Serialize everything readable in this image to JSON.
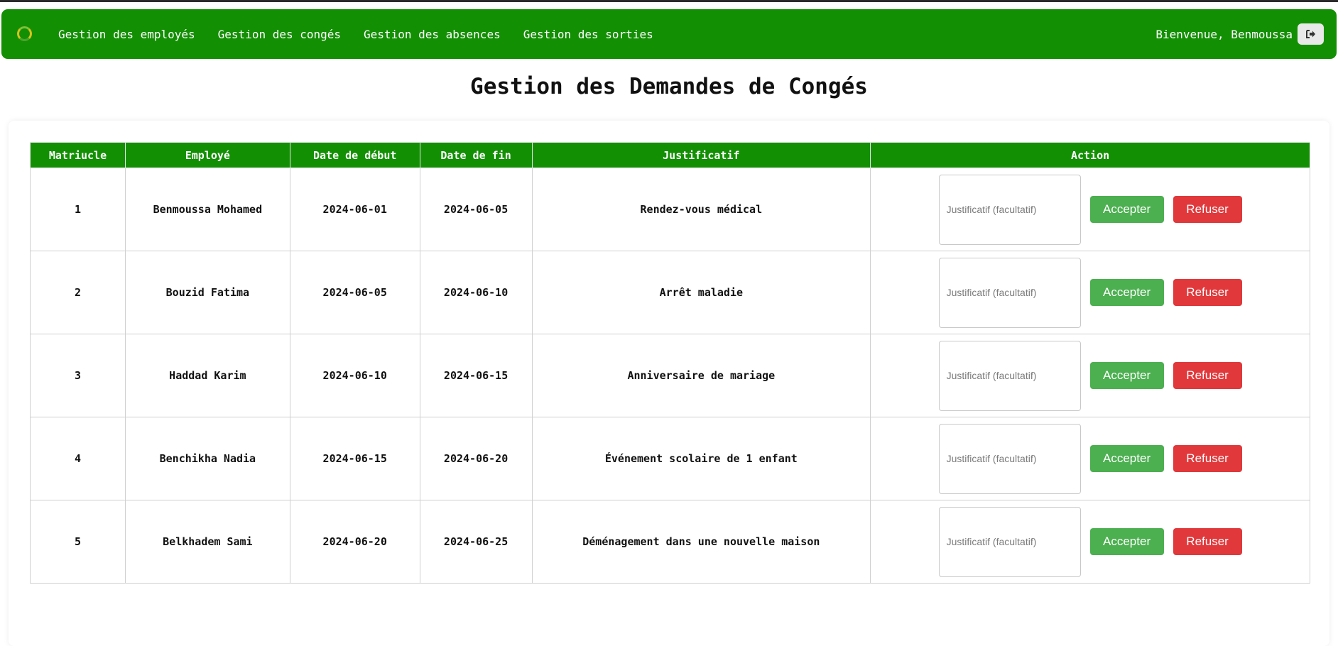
{
  "nav": {
    "links": [
      "Gestion des employés",
      "Gestion des congés",
      "Gestion des absences",
      "Gestion des sorties"
    ],
    "welcome": "Bienvenue, Benmoussa",
    "logout_icon": "sign-out-icon"
  },
  "page": {
    "title": "Gestion des Demandes de Congés"
  },
  "table": {
    "headers": [
      "Matriucle",
      "Employé",
      "Date de début",
      "Date de fin",
      "Justificatif",
      "Action"
    ],
    "rows": [
      {
        "matricule": "1",
        "employe": "Benmoussa Mohamed",
        "debut": "2024-06-01",
        "fin": "2024-06-05",
        "justificatif": "Rendez-vous médical"
      },
      {
        "matricule": "2",
        "employe": "Bouzid Fatima",
        "debut": "2024-06-05",
        "fin": "2024-06-10",
        "justificatif": "Arrêt maladie"
      },
      {
        "matricule": "3",
        "employe": "Haddad Karim",
        "debut": "2024-06-10",
        "fin": "2024-06-15",
        "justificatif": "Anniversaire de mariage"
      },
      {
        "matricule": "4",
        "employe": "Benchikha Nadia",
        "debut": "2024-06-15",
        "fin": "2024-06-20",
        "justificatif": "Événement scolaire de 1 enfant"
      },
      {
        "matricule": "5",
        "employe": "Belkhadem Sami",
        "debut": "2024-06-20",
        "fin": "2024-06-25",
        "justificatif": "Déménagement dans une nouvelle maison"
      }
    ],
    "action": {
      "input_placeholder": "Justificatif (facultatif)",
      "accept_label": "Accepter",
      "refuse_label": "Refuser"
    }
  },
  "colors": {
    "brand": "#138f04",
    "accept": "#4caf50",
    "refuse": "#e0383b"
  }
}
